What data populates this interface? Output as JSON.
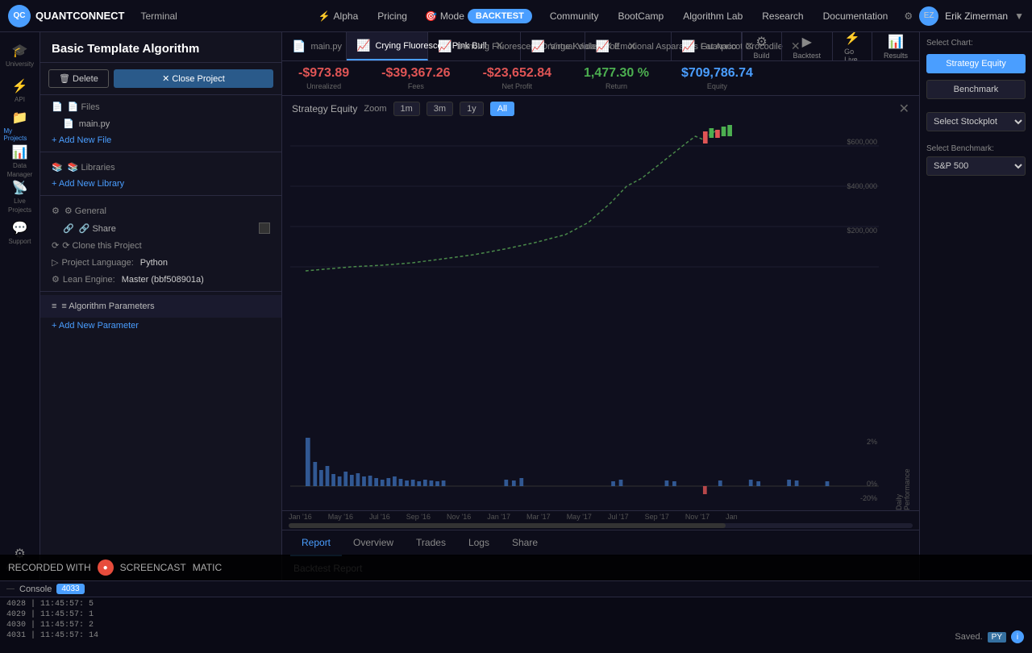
{
  "app": {
    "logo_text": "QUANTCONNECT",
    "terminal_label": "Terminal"
  },
  "nav": {
    "items": [
      {
        "label": "Alpha",
        "active": false
      },
      {
        "label": "Pricing",
        "active": false
      },
      {
        "label": "Mode",
        "active": false
      },
      {
        "label": "BACKTEST",
        "active": true
      },
      {
        "label": "Community",
        "active": false
      },
      {
        "label": "BootCamp",
        "active": false
      },
      {
        "label": "Algorithm Lab",
        "active": false
      },
      {
        "label": "Research",
        "active": false
      },
      {
        "label": "Documentation",
        "active": false
      }
    ],
    "user": "Erik Zimerman"
  },
  "sidebar_icons": [
    {
      "name": "university",
      "label": "University",
      "symbol": "🎓"
    },
    {
      "name": "api",
      "label": "API",
      "symbol": "⚡"
    },
    {
      "name": "my-projects",
      "label": "My Projects",
      "symbol": "📁"
    },
    {
      "name": "data",
      "label": "Data\nManager",
      "symbol": "📊"
    },
    {
      "name": "live-projects",
      "label": "Live\nProjects",
      "symbol": "📡"
    },
    {
      "name": "support",
      "label": "Support",
      "symbol": "💬"
    },
    {
      "name": "algorithm",
      "label": "Algorithm",
      "symbol": "⚙"
    }
  ],
  "project": {
    "title": "Basic Template Algorithm",
    "delete_label": "🗑 Delete",
    "close_label": "✕ Close Project",
    "files_label": "📄 Files",
    "main_file": "main.py",
    "add_file_label": "+ Add New File",
    "libraries_label": "📚 Libraries",
    "add_library_label": "+ Add New Library",
    "general_label": "⚙ General",
    "share_label": "🔗 Share",
    "clone_label": "⟳ Clone this Project",
    "language_label": "Project Language:",
    "language_value": "Python",
    "lean_label": "Lean Engine:",
    "lean_value": "Master (bbf508901a)",
    "params_label": "≡ Algorithm Parameters",
    "add_param_label": "+ Add New Parameter"
  },
  "tabs": [
    {
      "label": "main.py",
      "icon": "📄",
      "active": false
    },
    {
      "label": "Crying Fluorescent Pink Bull",
      "icon": "📈",
      "active": false
    },
    {
      "label": "Dancing Fluorescent Orange Koala",
      "icon": "📈",
      "active": false
    },
    {
      "label": "Virtual Violet Wolf",
      "icon": "📈",
      "active": false
    },
    {
      "label": "Emotional Asparagus Guanaco",
      "icon": "📈",
      "active": false
    },
    {
      "label": "Fat Apricot Crocodile",
      "icon": "📈",
      "active": false
    }
  ],
  "toolbar_buttons": [
    {
      "label": "Build",
      "icon": "⚙"
    },
    {
      "label": "Backtest",
      "icon": "▶"
    },
    {
      "label": "Go Live",
      "icon": "⚡"
    },
    {
      "label": "Results",
      "icon": "📊"
    }
  ],
  "stats": [
    {
      "value": "-$973.89",
      "label": "Unrealized",
      "type": "negative"
    },
    {
      "value": "-$39,367.26",
      "label": "Fees",
      "type": "negative"
    },
    {
      "value": "-$23,652.84",
      "label": "Net Profit",
      "type": "negative"
    },
    {
      "value": "1,477.30 %",
      "label": "Return",
      "type": "green"
    },
    {
      "value": "$709,786.74",
      "label": "Equity",
      "type": "positive"
    }
  ],
  "chart": {
    "title": "Strategy Equity",
    "zoom_label": "Zoom",
    "zoom_options": [
      "1m",
      "3m",
      "1y",
      "All"
    ],
    "active_zoom": "All",
    "y_labels": [
      "$600,000",
      "$400,000",
      "$200,000"
    ],
    "x_labels": [
      "Jan '16",
      "May '16",
      "Sep '16",
      "Jan '17",
      "May '17",
      "Sep '17",
      "Jan"
    ],
    "daily_label": "Daily Performance",
    "daily_y_labels": [
      "2%",
      "0%",
      "-20%"
    ]
  },
  "bottom_tabs": [
    "Report",
    "Overview",
    "Trades",
    "Logs",
    "Share"
  ],
  "active_bottom_tab": "Report",
  "report_title": "Backtest Report",
  "right_sidebar": {
    "select_chart_label": "Select Chart:",
    "strategy_equity_label": "Strategy Equity",
    "benchmark_label": "Benchmark",
    "select_stockplot_label": "Select Stockplot",
    "select_benchmark_label": "Select Benchmark:",
    "sp500_label": "S&P 500"
  },
  "console": {
    "label": "Console",
    "badge": "4033",
    "lines": [
      "4028 | 11:45:57: 5",
      "4029 | 11:45:57: 1",
      "4030 | 11:45:57: 2",
      "4031 | 11:45:57: 14"
    ]
  },
  "status": {
    "saved_text": "Saved.",
    "py_badge": "PY"
  },
  "watermark": {
    "text": "RECORDED WITH",
    "brand": "SCREENCAST",
    "suffix": "MATIC"
  },
  "timeline": {
    "labels": [
      "Jan '16",
      "May '16",
      "Jul '16",
      "Sep '16",
      "Nov '16",
      "Jan '17",
      "Mar '17",
      "May '17",
      "Jul '17",
      "Sep '17",
      "Nov '17",
      "Jan"
    ]
  }
}
